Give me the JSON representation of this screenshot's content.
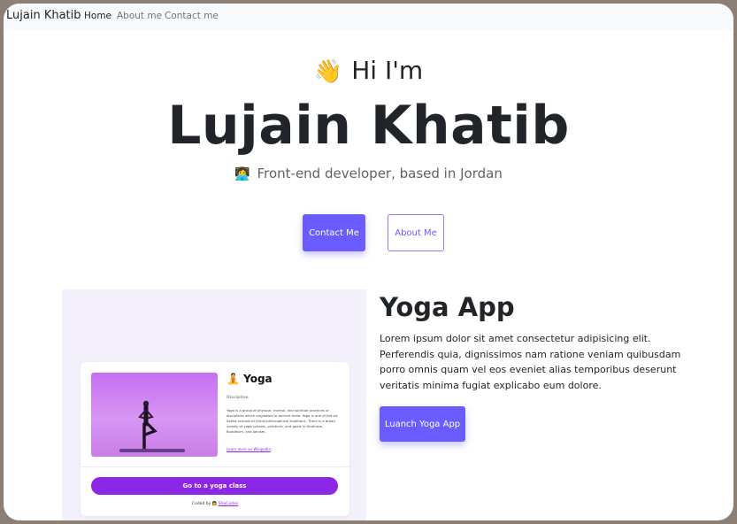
{
  "nav": {
    "brand": "Lujain Khatib",
    "links": [
      "Home",
      "About me",
      "Contact me"
    ]
  },
  "hero": {
    "wave_emoji": "👋",
    "greeting": "Hi I'm",
    "name": "Lujain Khatib",
    "tagline_emoji": "👩‍💻",
    "tagline": "Front-end developer, based in Jordan",
    "contact_button": "Contact Me",
    "about_button": "About Me"
  },
  "project": {
    "title": "Yoga App",
    "description": "Lorem ipsum dolor sit amet consectetur adipisicing elit. Perferendis quia, dignissimos nam ratione veniam quibusdam porro omnis quam vel eos eveniet alias temporibus deserunt veritatis minima fugiat explicabo eum dolore.",
    "launch_button": "Luanch Yoga App",
    "preview": {
      "title": "🧘 Yoga",
      "label": "Discipline",
      "text": "Yoga is a group of physical, mental, and spiritual practices or disciplines which originated in ancient India. Yoga is one of the six Āstika schools of Hindu philosophical traditions. There is a broad variety of yoga schools, practices, and goals in Hinduism, Buddhism, and Jainism.",
      "link": "Learn more on Wikipedia",
      "button": "Go to a yoga class",
      "footer_prefix": "Coded by 👩",
      "footer_link": "SheCodes"
    }
  },
  "colors": {
    "accent": "#6b5cff",
    "preview_bg": "#f3f0fc",
    "card_button": "#8b27e5"
  }
}
